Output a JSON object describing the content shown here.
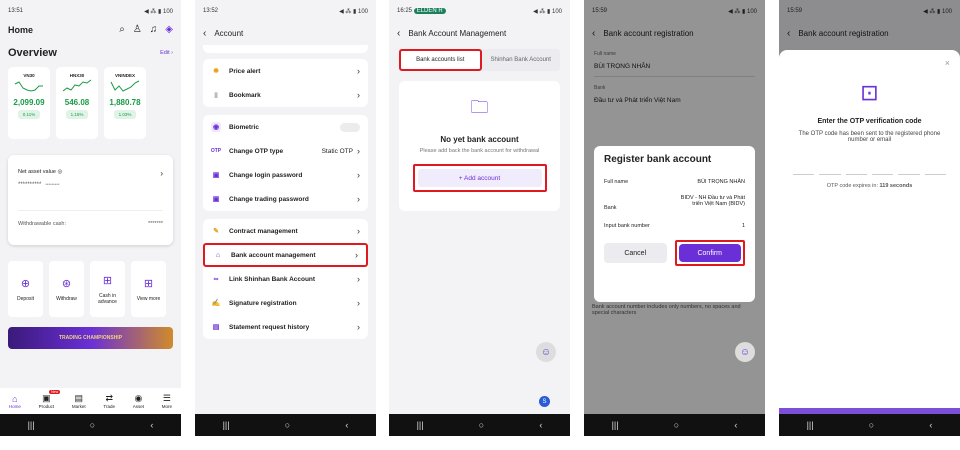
{
  "screen1": {
    "status_time": "13:51",
    "status_right": "◀ ⁂ ▮ 100",
    "title": "Home",
    "overview_title": "Overview",
    "edit_label": "Edit",
    "indices": [
      {
        "name": "VN30",
        "value": "2,099.09",
        "pct": "0.11%"
      },
      {
        "name": "HNX30",
        "value": "546.08",
        "pct": "1.15%"
      },
      {
        "name": "VNINDEX",
        "value": "1,880.78",
        "pct": "1.03%"
      }
    ],
    "nav_label": "Net asset value",
    "nav_value_mask": "**********",
    "nav_value_mask2": "*********",
    "withdraw_label": "Withdrawable cash:",
    "withdraw_mask": "*******",
    "quick": [
      {
        "icon": "deposit-icon",
        "label": "Deposit"
      },
      {
        "icon": "withdraw-icon",
        "label": "Withdraw"
      },
      {
        "icon": "cash-advance-icon",
        "label": "Cash in advance"
      },
      {
        "icon": "view-more-icon",
        "label": "View more"
      }
    ],
    "banner_text": "TRADING CHAMPIONSHIP",
    "tabs": [
      "Home",
      "Product",
      "Market",
      "Trade",
      "Asset",
      "More"
    ],
    "product_badge": "New"
  },
  "screen2": {
    "status_time": "13:52",
    "status_right": "◀ ⁂ ▮ 100",
    "title": "Account",
    "items": [
      {
        "label": "Price alert",
        "value": ""
      },
      {
        "label": "Bookmark",
        "value": ""
      },
      {
        "label": "Biometric",
        "value": ""
      },
      {
        "label": "Change OTP type",
        "value": "Static OTP"
      },
      {
        "label": "Change login password",
        "value": ""
      },
      {
        "label": "Change trading password",
        "value": ""
      },
      {
        "label": "Contract management",
        "value": ""
      },
      {
        "label": "Bank account management",
        "value": ""
      },
      {
        "label": "Link Shinhan Bank Account",
        "value": ""
      },
      {
        "label": "Signature registration",
        "value": ""
      },
      {
        "label": "Statement request history",
        "value": ""
      }
    ]
  },
  "screen3": {
    "status_time": "16:25",
    "status_pill": "ELDEN R",
    "status_right": "◀ ⁂ ▮ 100",
    "title": "Bank Account Management",
    "tab_active": "Bank accounts list",
    "tab_inactive": "Shinhan Bank Account",
    "empty_title": "No yet bank account",
    "empty_desc": "Please add back the bank account for withdrawal",
    "add_button": "+ Add account"
  },
  "screen4": {
    "status_time": "15:59",
    "status_right": "◀ ⁂ ▮ 100",
    "title": "Bank account registration",
    "fullname_label": "Full name",
    "fullname_value": "BÙI TRỌNG NHÂN",
    "bank_label": "Bank",
    "bank_value": "Đầu tư và Phát triển Việt Nam",
    "modal_title": "Register bank account",
    "m_fullname_label": "Full name",
    "m_fullname_value": "BÙI TRỌNG NHÂN",
    "m_bank_label": "Bank",
    "m_bank_value": "BIDV - NH Đầu tư và Phát triển Việt Nam (BIDV)",
    "m_input_label": "Input bank number",
    "m_input_value": "1",
    "cancel": "Cancel",
    "confirm": "Confirm",
    "hint": "Bank account number includes only numbers, no spaces and special characters"
  },
  "screen5": {
    "status_time": "15:59",
    "status_right": "◀ ⁂ ▮ 100",
    "title": "Bank account registration",
    "otp_title": "Enter the OTP verification code",
    "otp_desc": "The OTP code has been sent to the registered phone number or email",
    "expires_label": "OTP code expires in:",
    "expires_value": "119 seconds"
  },
  "colors": {
    "accent": "#6a2fd6",
    "highlight": "#e0191f",
    "up": "#1a9b47"
  }
}
